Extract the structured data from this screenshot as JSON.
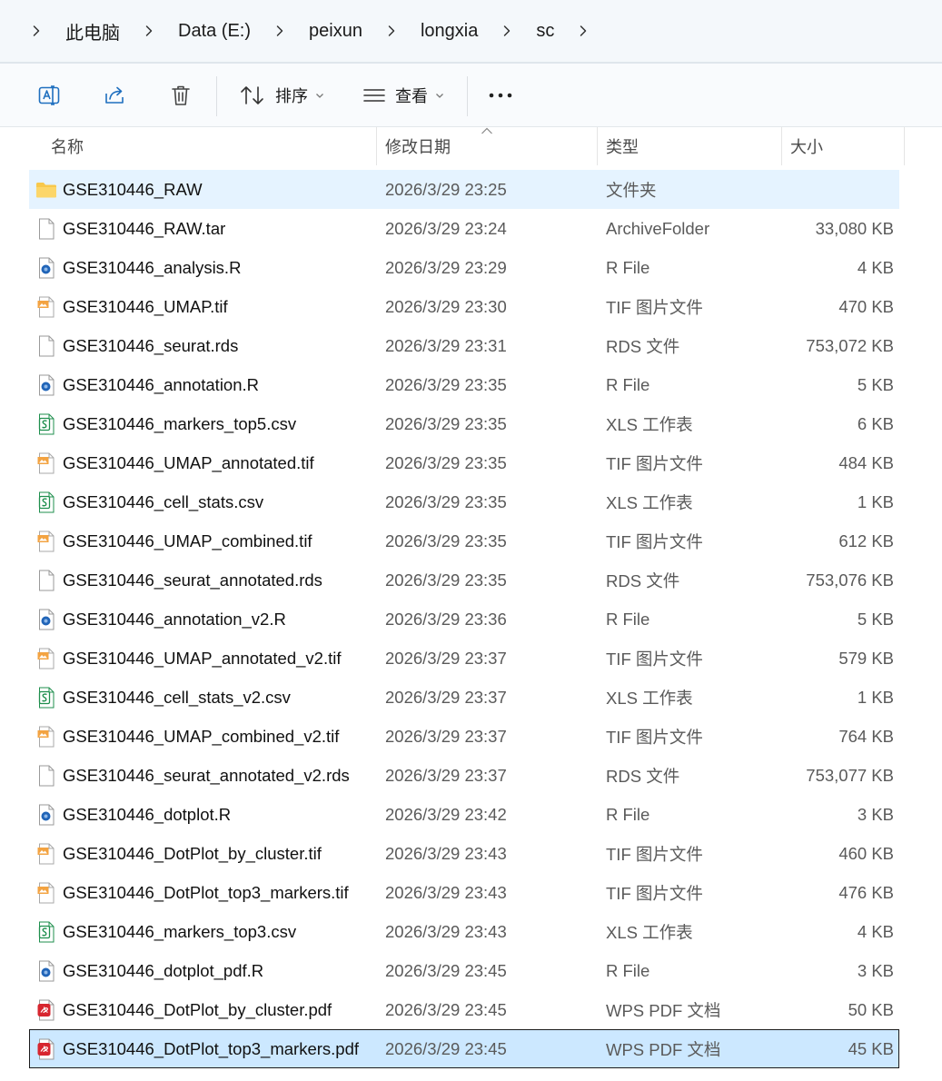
{
  "breadcrumb": [
    "此电脑",
    "Data (E:)",
    "peixun",
    "longxia",
    "sc"
  ],
  "toolbar": {
    "sort_label": "排序",
    "view_label": "查看",
    "more_label": "···"
  },
  "columns": {
    "name": "名称",
    "date": "修改日期",
    "type": "类型",
    "size": "大小"
  },
  "files": [
    {
      "name": "GSE310446_RAW",
      "date": "2026/3/29 23:25",
      "type": "文件夹",
      "size": "",
      "icon": "folder-icon",
      "state": "hover"
    },
    {
      "name": "GSE310446_RAW.tar",
      "date": "2026/3/29 23:24",
      "type": "ArchiveFolder",
      "size": "33,080 KB",
      "icon": "blank-file-icon"
    },
    {
      "name": "GSE310446_analysis.R",
      "date": "2026/3/29 23:29",
      "type": "R File",
      "size": "4 KB",
      "icon": "r-file-icon"
    },
    {
      "name": "GSE310446_UMAP.tif",
      "date": "2026/3/29 23:30",
      "type": "TIF 图片文件",
      "size": "470 KB",
      "icon": "image-file-icon"
    },
    {
      "name": "GSE310446_seurat.rds",
      "date": "2026/3/29 23:31",
      "type": "RDS 文件",
      "size": "753,072 KB",
      "icon": "blank-file-icon"
    },
    {
      "name": "GSE310446_annotation.R",
      "date": "2026/3/29 23:35",
      "type": "R File",
      "size": "5 KB",
      "icon": "r-file-icon"
    },
    {
      "name": "GSE310446_markers_top5.csv",
      "date": "2026/3/29 23:35",
      "type": "XLS 工作表",
      "size": "6 KB",
      "icon": "spreadsheet-file-icon"
    },
    {
      "name": "GSE310446_UMAP_annotated.tif",
      "date": "2026/3/29 23:35",
      "type": "TIF 图片文件",
      "size": "484 KB",
      "icon": "image-file-icon"
    },
    {
      "name": "GSE310446_cell_stats.csv",
      "date": "2026/3/29 23:35",
      "type": "XLS 工作表",
      "size": "1 KB",
      "icon": "spreadsheet-file-icon"
    },
    {
      "name": "GSE310446_UMAP_combined.tif",
      "date": "2026/3/29 23:35",
      "type": "TIF 图片文件",
      "size": "612 KB",
      "icon": "image-file-icon"
    },
    {
      "name": "GSE310446_seurat_annotated.rds",
      "date": "2026/3/29 23:35",
      "type": "RDS 文件",
      "size": "753,076 KB",
      "icon": "blank-file-icon"
    },
    {
      "name": "GSE310446_annotation_v2.R",
      "date": "2026/3/29 23:36",
      "type": "R File",
      "size": "5 KB",
      "icon": "r-file-icon"
    },
    {
      "name": "GSE310446_UMAP_annotated_v2.tif",
      "date": "2026/3/29 23:37",
      "type": "TIF 图片文件",
      "size": "579 KB",
      "icon": "image-file-icon"
    },
    {
      "name": "GSE310446_cell_stats_v2.csv",
      "date": "2026/3/29 23:37",
      "type": "XLS 工作表",
      "size": "1 KB",
      "icon": "spreadsheet-file-icon"
    },
    {
      "name": "GSE310446_UMAP_combined_v2.tif",
      "date": "2026/3/29 23:37",
      "type": "TIF 图片文件",
      "size": "764 KB",
      "icon": "image-file-icon"
    },
    {
      "name": "GSE310446_seurat_annotated_v2.rds",
      "date": "2026/3/29 23:37",
      "type": "RDS 文件",
      "size": "753,077 KB",
      "icon": "blank-file-icon"
    },
    {
      "name": "GSE310446_dotplot.R",
      "date": "2026/3/29 23:42",
      "type": "R File",
      "size": "3 KB",
      "icon": "r-file-icon"
    },
    {
      "name": "GSE310446_DotPlot_by_cluster.tif",
      "date": "2026/3/29 23:43",
      "type": "TIF 图片文件",
      "size": "460 KB",
      "icon": "image-file-icon"
    },
    {
      "name": "GSE310446_DotPlot_top3_markers.tif",
      "date": "2026/3/29 23:43",
      "type": "TIF 图片文件",
      "size": "476 KB",
      "icon": "image-file-icon"
    },
    {
      "name": "GSE310446_markers_top3.csv",
      "date": "2026/3/29 23:43",
      "type": "XLS 工作表",
      "size": "4 KB",
      "icon": "spreadsheet-file-icon"
    },
    {
      "name": "GSE310446_dotplot_pdf.R",
      "date": "2026/3/29 23:45",
      "type": "R File",
      "size": "3 KB",
      "icon": "r-file-icon"
    },
    {
      "name": "GSE310446_DotPlot_by_cluster.pdf",
      "date": "2026/3/29 23:45",
      "type": "WPS PDF 文档",
      "size": "50 KB",
      "icon": "pdf-file-icon"
    },
    {
      "name": "GSE310446_DotPlot_top3_markers.pdf",
      "date": "2026/3/29 23:45",
      "type": "WPS PDF 文档",
      "size": "45 KB",
      "icon": "pdf-file-icon",
      "state": "selected"
    }
  ],
  "colors": {
    "hover": "#e5f3ff",
    "selected": "#cce8ff",
    "folder": "#f8c84c",
    "pdf": "#d7262f",
    "spreadsheet": "#1f8f4e",
    "r_file": "#2165b8",
    "toolbar_icon": "#1f6fbf"
  }
}
